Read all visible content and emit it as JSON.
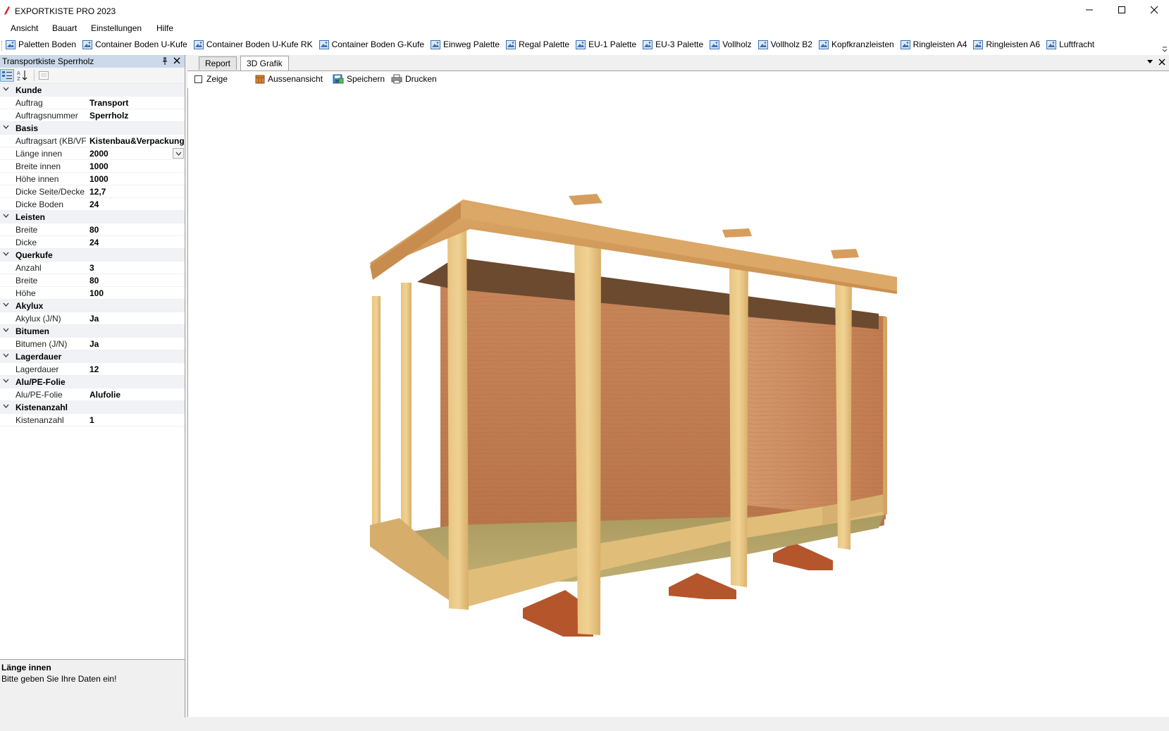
{
  "window": {
    "title": "EXPORTKISTE PRO 2023",
    "brand_color": "#e03030"
  },
  "menu": [
    "Ansicht",
    "Bauart",
    "Einstellungen",
    "Hilfe"
  ],
  "toolbar": {
    "items": [
      "Paletten Boden",
      "Container Boden U-Kufe",
      "Container Boden U-Kufe RK",
      "Container Boden G-Kufe",
      "Einweg Palette",
      "Regal Palette",
      "EU-1 Palette",
      "EU-3 Palette",
      "Vollholz",
      "Vollholz B2",
      "Kopfkranzleisten",
      "Ringleisten A4",
      "Ringleisten A6",
      "Luftfracht"
    ]
  },
  "panel": {
    "title": "Transportkiste Sperrholz",
    "categories": [
      {
        "name": "Kunde",
        "props": [
          {
            "name": "Auftrag",
            "value": "Transport"
          },
          {
            "name": "Auftragsnummer",
            "value": "Sperrholz"
          }
        ]
      },
      {
        "name": "Basis",
        "props": [
          {
            "name": "Auftragsart (KB/VF",
            "value": "Kistenbau&Verpackung"
          },
          {
            "name": "Länge innen",
            "value": "2000",
            "selected": true
          },
          {
            "name": "Breite innen",
            "value": "1000"
          },
          {
            "name": "Höhe innen",
            "value": "1000"
          },
          {
            "name": "Dicke Seite/Decke",
            "value": "12,7"
          },
          {
            "name": "Dicke Boden",
            "value": "24"
          }
        ]
      },
      {
        "name": "Leisten",
        "props": [
          {
            "name": "Breite",
            "value": "80"
          },
          {
            "name": "Dicke",
            "value": "24"
          }
        ]
      },
      {
        "name": "Querkufe",
        "props": [
          {
            "name": "Anzahl",
            "value": "3"
          },
          {
            "name": "Breite",
            "value": "80"
          },
          {
            "name": "Höhe",
            "value": "100"
          }
        ]
      },
      {
        "name": "Akylux",
        "props": [
          {
            "name": "Akylux (J/N)",
            "value": "Ja"
          }
        ]
      },
      {
        "name": "Bitumen",
        "props": [
          {
            "name": "Bitumen (J/N)",
            "value": "Ja"
          }
        ]
      },
      {
        "name": "Lagerdauer",
        "props": [
          {
            "name": "Lagerdauer",
            "value": "12"
          }
        ]
      },
      {
        "name": "Alu/PE-Folie",
        "props": [
          {
            "name": "Alu/PE-Folie",
            "value": "Alufolie"
          }
        ]
      },
      {
        "name": "Kistenanzahl",
        "props": [
          {
            "name": "Kistenanzahl",
            "value": "1"
          }
        ]
      }
    ],
    "help": {
      "title": "Länge innen",
      "text": "Bitte geben Sie Ihre Daten ein!"
    }
  },
  "tabs": [
    {
      "label": "Report",
      "active": false
    },
    {
      "label": "3D Grafik",
      "active": true
    }
  ],
  "viewtools": {
    "show_label": "Zeige",
    "show_checked": false,
    "outside_view": "Aussenansicht",
    "save": "Speichern",
    "print": "Drucken"
  }
}
